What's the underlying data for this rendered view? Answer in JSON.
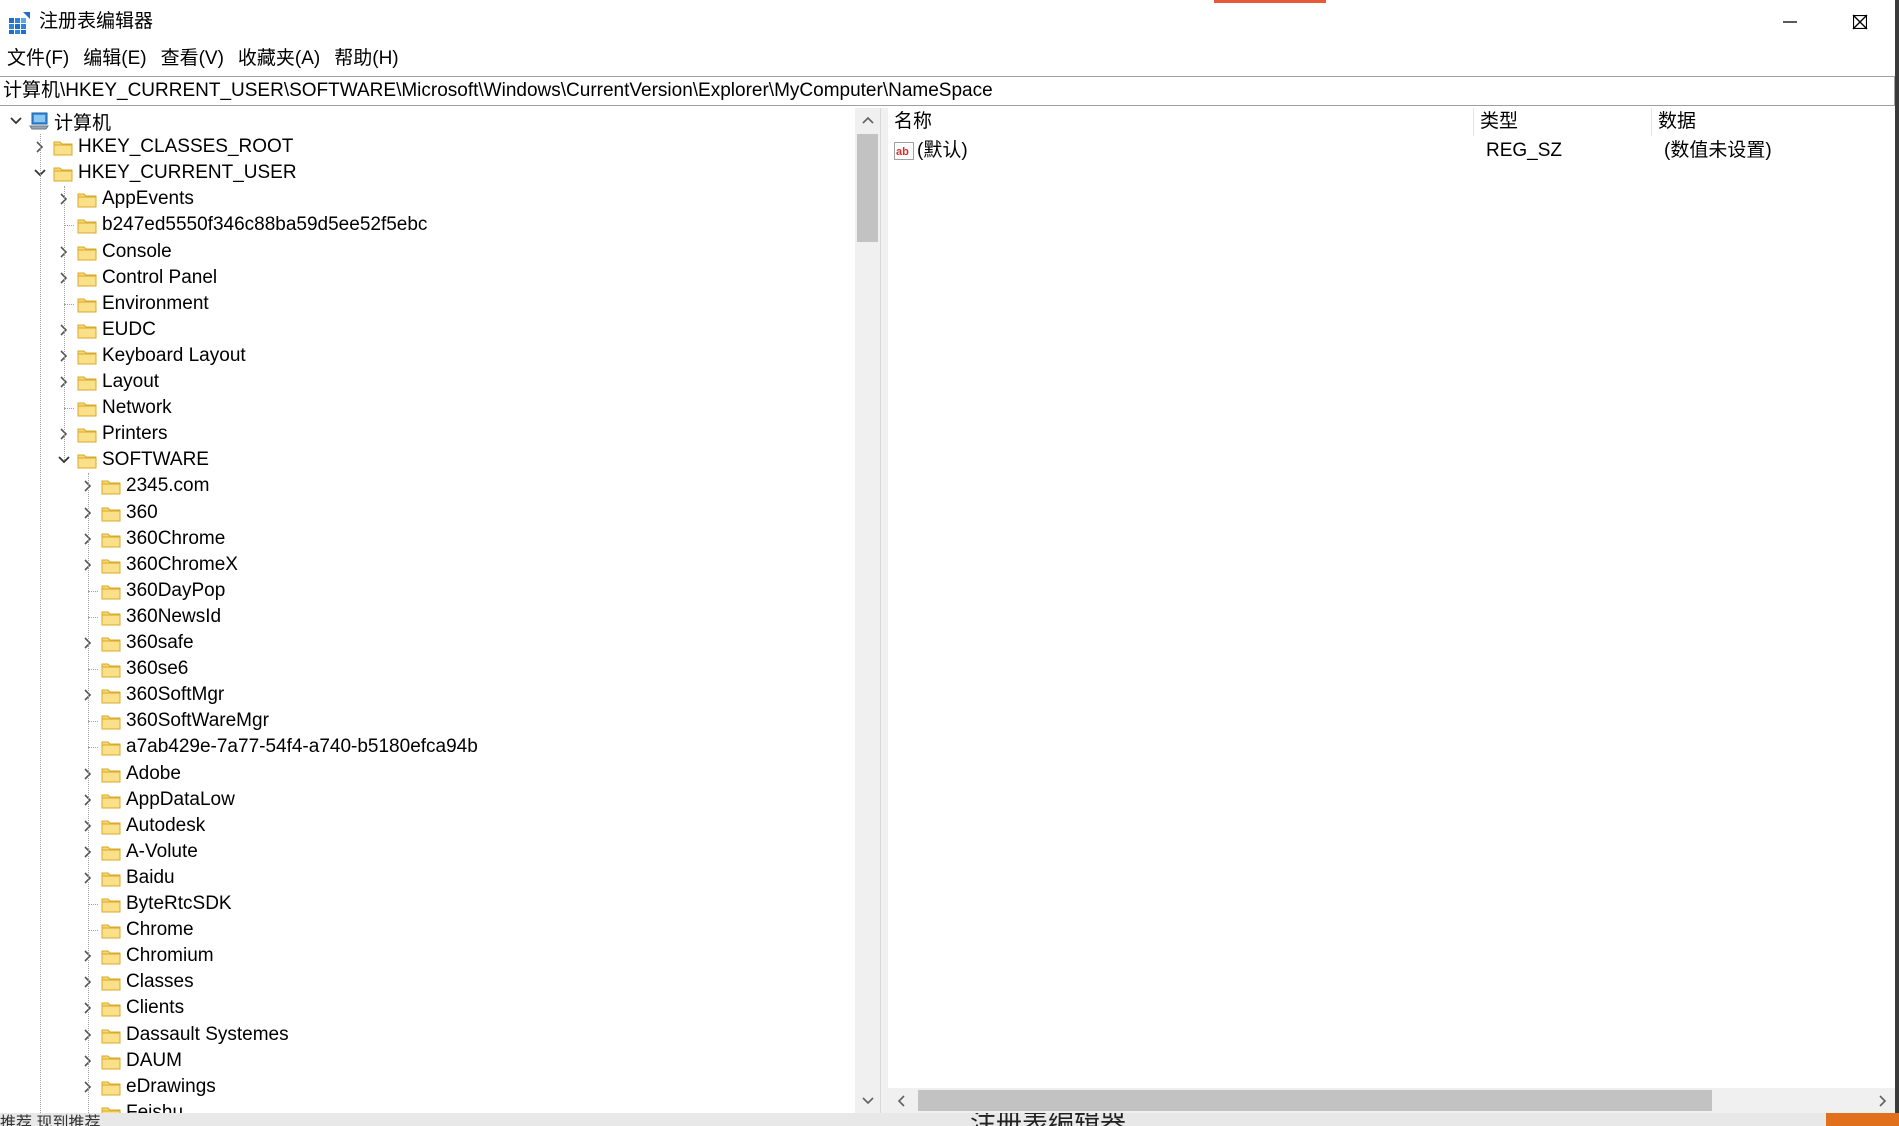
{
  "window": {
    "title": "注册表编辑器",
    "accent_color": "#e8593a"
  },
  "menu": [
    "文件(F)",
    "编辑(E)",
    "查看(V)",
    "收藏夹(A)",
    "帮助(H)"
  ],
  "address": "计算机\\HKEY_CURRENT_USER\\SOFTWARE\\Microsoft\\Windows\\CurrentVersion\\Explorer\\MyComputer\\NameSpace",
  "tree": {
    "root": "计算机",
    "hives": [
      "HKEY_CLASSES_ROOT",
      "HKEY_CURRENT_USER"
    ],
    "hkcu_children": [
      "AppEvents",
      "b247ed5550f346c88ba59d5ee52f5ebc",
      "Console",
      "Control Panel",
      "Environment",
      "EUDC",
      "Keyboard Layout",
      "Layout",
      "Network",
      "Printers",
      "SOFTWARE"
    ],
    "hkcu_expandable": [
      true,
      false,
      true,
      true,
      false,
      true,
      true,
      true,
      false,
      true,
      true
    ],
    "software_children": [
      "2345.com",
      "360",
      "360Chrome",
      "360ChromeX",
      "360DayPop",
      "360NewsId",
      "360safe",
      "360se6",
      "360SoftMgr",
      "360SoftWareMgr",
      "a7ab429e-7a77-54f4-a740-b5180efca94b",
      "Adobe",
      "AppDataLow",
      "Autodesk",
      "A-Volute",
      "Baidu",
      "ByteRtcSDK",
      "Chrome",
      "Chromium",
      "Classes",
      "Clients",
      "Dassault Systemes",
      "DAUM",
      "eDrawings",
      "Feishu"
    ],
    "software_expandable": [
      true,
      true,
      true,
      true,
      false,
      false,
      true,
      false,
      true,
      false,
      false,
      true,
      true,
      true,
      true,
      true,
      false,
      false,
      true,
      true,
      true,
      true,
      true,
      true,
      false
    ]
  },
  "list": {
    "columns": [
      "名称",
      "类型",
      "数据"
    ],
    "rows": [
      {
        "name": "(默认)",
        "type": "REG_SZ",
        "data": "(数值未设置)"
      }
    ]
  },
  "background": {
    "taskbar_text": "推荐    现到推荐",
    "behind_title": "注册表编辑器"
  }
}
